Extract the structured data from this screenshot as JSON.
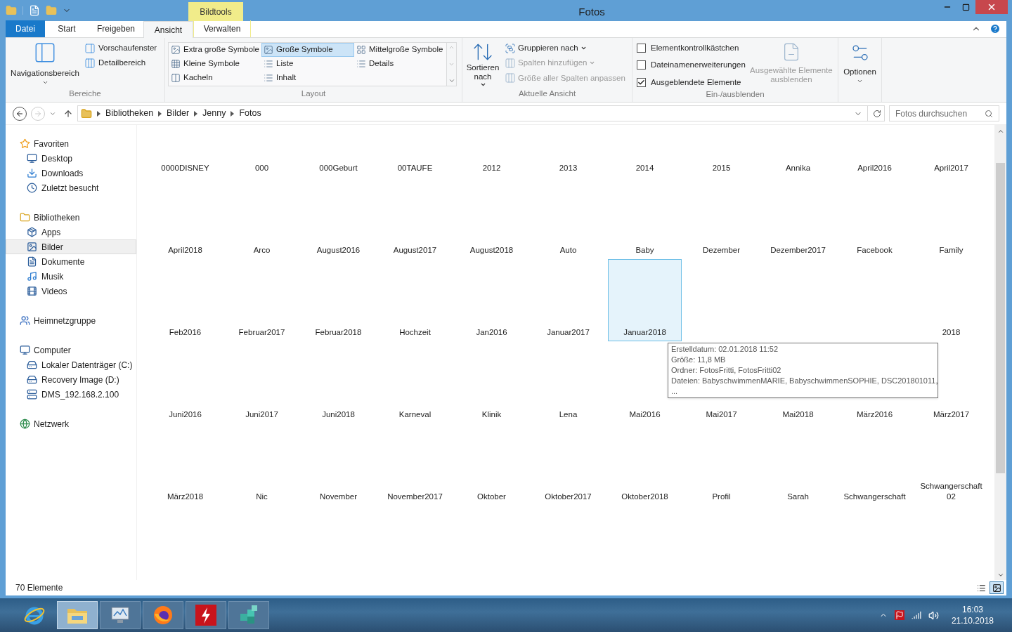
{
  "title_bar": {
    "contextual_tab": "Bildtools",
    "title": "Fotos"
  },
  "ribbon_tabs": [
    {
      "label": "Datei",
      "kind": "file",
      "selected": false
    },
    {
      "label": "Start",
      "kind": "tab",
      "selected": false
    },
    {
      "label": "Freigeben",
      "kind": "tab",
      "selected": false
    },
    {
      "label": "Ansicht",
      "kind": "tab",
      "selected": true
    },
    {
      "label": "Verwalten",
      "kind": "context",
      "selected": false
    }
  ],
  "bereiche": {
    "label": "Bereiche",
    "large": "Navigationsbereich",
    "small": [
      "Vorschaufenster",
      "Detailbereich"
    ]
  },
  "layout": {
    "label": "Layout",
    "options": [
      {
        "label": "Extra große Symbole",
        "selected": false
      },
      {
        "label": "Große Symbole",
        "selected": true
      },
      {
        "label": "Mittelgroße Symbole",
        "selected": false
      },
      {
        "label": "Kleine Symbole",
        "selected": false
      },
      {
        "label": "Liste",
        "selected": false
      },
      {
        "label": "Details",
        "selected": false
      },
      {
        "label": "Kacheln",
        "selected": false
      },
      {
        "label": "Inhalt",
        "selected": false
      }
    ]
  },
  "aktuelle_ansicht": {
    "label": "Aktuelle Ansicht",
    "sort": "Sortieren nach",
    "items": [
      {
        "label": "Gruppieren nach",
        "disabled": false,
        "dropdown": true
      },
      {
        "label": "Spalten hinzufügen",
        "disabled": true,
        "dropdown": true
      },
      {
        "label": "Größe aller Spalten anpassen",
        "disabled": true,
        "dropdown": false
      }
    ]
  },
  "ein_ausblenden": {
    "label": "Ein-/ausblenden",
    "checkboxes": [
      {
        "label": "Elementkontrollkästchen",
        "checked": false
      },
      {
        "label": "Dateinamenerweiterungen",
        "checked": false
      },
      {
        "label": "Ausgeblendete Elemente",
        "checked": true
      }
    ],
    "hide_button": {
      "label": "Ausgewählte Elemente ausblenden",
      "disabled": true
    }
  },
  "optionen": {
    "label": "Optionen"
  },
  "address": {
    "crumbs": [
      "Bibliotheken",
      "Bilder",
      "Jenny",
      "Fotos"
    ],
    "search_placeholder": "Fotos durchsuchen"
  },
  "navigation": [
    {
      "label": "Favoriten",
      "kind": "star",
      "selected": false,
      "children": [
        {
          "label": "Desktop",
          "kind": "desktop",
          "selected": false
        },
        {
          "label": "Downloads",
          "kind": "downloads",
          "selected": false
        },
        {
          "label": "Zuletzt besucht",
          "kind": "recent",
          "selected": false
        }
      ]
    },
    {
      "label": "Bibliotheken",
      "kind": "library",
      "selected": false,
      "children": [
        {
          "label": "Apps",
          "kind": "apps",
          "selected": false
        },
        {
          "label": "Bilder",
          "kind": "pictures",
          "selected": true
        },
        {
          "label": "Dokumente",
          "kind": "documents",
          "selected": false
        },
        {
          "label": "Musik",
          "kind": "music",
          "selected": false
        },
        {
          "label": "Videos",
          "kind": "videos",
          "selected": false
        }
      ]
    },
    {
      "label": "Heimnetzgruppe",
      "kind": "homegroup",
      "selected": false
    },
    {
      "label": "Computer",
      "kind": "computer",
      "selected": false,
      "children": [
        {
          "label": "Lokaler Datenträger (C:)",
          "kind": "drive",
          "selected": false
        },
        {
          "label": "Recovery Image (D:)",
          "kind": "drive",
          "selected": false
        },
        {
          "label": "DMS_192.168.2.100",
          "kind": "server",
          "selected": false
        }
      ]
    },
    {
      "label": "Netzwerk",
      "kind": "network",
      "selected": false
    }
  ],
  "items": [
    [
      {
        "label": "0000DISNEY",
        "selected": false
      },
      {
        "label": "000",
        "selected": false
      },
      {
        "label": "000Geburt",
        "selected": false
      },
      {
        "label": "00TAUFE",
        "selected": false
      },
      {
        "label": "2012",
        "selected": false
      },
      {
        "label": "2013",
        "selected": false
      },
      {
        "label": "2014",
        "selected": false
      },
      {
        "label": "2015",
        "selected": false
      },
      {
        "label": "Annika",
        "selected": false
      },
      {
        "label": "April2016",
        "selected": false
      },
      {
        "label": "April2017",
        "selected": false
      }
    ],
    [
      {
        "label": "April2018",
        "selected": false
      },
      {
        "label": "Arco",
        "selected": false
      },
      {
        "label": "August2016",
        "selected": false
      },
      {
        "label": "August2017",
        "selected": false
      },
      {
        "label": "August2018",
        "selected": false
      },
      {
        "label": "Auto",
        "selected": false
      },
      {
        "label": "Baby",
        "selected": false
      },
      {
        "label": "Dezember",
        "selected": false
      },
      {
        "label": "Dezember2017",
        "selected": false
      },
      {
        "label": "Facebook",
        "selected": false
      },
      {
        "label": "Family",
        "selected": false
      }
    ],
    [
      {
        "label": "Feb2016",
        "selected": false
      },
      {
        "label": "Februar2017",
        "selected": false
      },
      {
        "label": "Februar2018",
        "selected": false
      },
      {
        "label": "Hochzeit",
        "selected": false
      },
      {
        "label": "Jan2016",
        "selected": false
      },
      {
        "label": "Januar2017",
        "selected": false
      },
      {
        "label": "Januar2018",
        "selected": true
      },
      {
        "label": "2018",
        "selected": false
      }
    ],
    [
      {
        "label": "Juni2016",
        "selected": false
      },
      {
        "label": "Juni2017",
        "selected": false
      },
      {
        "label": "Juni2018",
        "selected": false
      },
      {
        "label": "Karneval",
        "selected": false
      },
      {
        "label": "Klinik",
        "selected": false
      },
      {
        "label": "Lena",
        "selected": false
      },
      {
        "label": "Mai2016",
        "selected": false
      },
      {
        "label": "Mai2017",
        "selected": false
      },
      {
        "label": "Mai2018",
        "selected": false
      },
      {
        "label": "März2016",
        "selected": false
      },
      {
        "label": "März2017",
        "selected": false
      }
    ],
    [
      {
        "label": "März2018",
        "selected": false
      },
      {
        "label": "Nic",
        "selected": false
      },
      {
        "label": "November",
        "selected": false
      },
      {
        "label": "November2017",
        "selected": false
      },
      {
        "label": "Oktober",
        "selected": false
      },
      {
        "label": "Oktober2017",
        "selected": false
      },
      {
        "label": "Oktober2018",
        "selected": false
      },
      {
        "label": "Profil",
        "selected": false
      },
      {
        "label": "Sarah",
        "selected": false
      },
      {
        "label": "Schwangerschaft",
        "selected": false
      },
      {
        "label": "Schwangerschaft 02",
        "selected": false
      }
    ]
  ],
  "tooltip": [
    "Erstelldatum: 02.01.2018 11:52",
    "Größe: 11,8 MB",
    "Ordner: FotosFritti, FotosFritti02",
    "Dateien: BabyschwimmenMARIE, BabyschwimmenSOPHIE, DSC201801011,",
    "..."
  ],
  "status_bar": {
    "count": "70 Elemente",
    "views": [
      {
        "kind": "details",
        "selected": false
      },
      {
        "kind": "large",
        "selected": true
      }
    ]
  },
  "taskbar": {
    "apps": [
      {
        "kind": "ie",
        "selected": false
      },
      {
        "kind": "explorer",
        "selected": true
      },
      {
        "kind": "monitor",
        "selected": false
      },
      {
        "kind": "firefox",
        "selected": false
      },
      {
        "kind": "flash",
        "selected": false
      },
      {
        "kind": "cubes",
        "selected": false
      }
    ],
    "time": "16:03",
    "date": "21.10.2018"
  }
}
